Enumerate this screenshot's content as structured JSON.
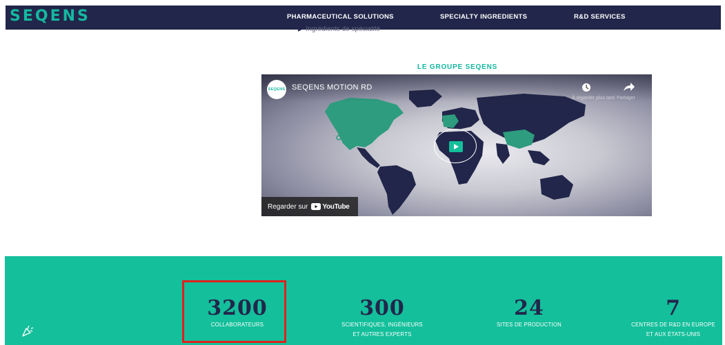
{
  "header": {
    "logo": "SEQENS",
    "nav": [
      "PHARMACEUTICAL SOLUTIONS",
      "SPECIALTY INGREDIENTS",
      "R&D SERVICES"
    ]
  },
  "cutoff_text": "Ingrédients de spécialité",
  "section_title": "LE GROUPE SEQENS",
  "video": {
    "channel_avatar_text": "SEQENS",
    "title": "SEQENS MOTION RD",
    "clock_label": "À regarder plus tard",
    "share_label": "Partager",
    "watch_on_label": "Regarder sur",
    "youtube_label": "YouTube"
  },
  "stats": [
    {
      "number": "3200",
      "label_line1": "COLLABORATEURS",
      "label_line2": ""
    },
    {
      "number": "300",
      "label_line1": "SCIENTIFIQUES, INGÉNIEURS",
      "label_line2": "ET AUTRES EXPERTS"
    },
    {
      "number": "24",
      "label_line1": "SITES DE PRODUCTION",
      "label_line2": ""
    },
    {
      "number": "7",
      "label_line1": "CENTRES DE R&D EN EUROPE",
      "label_line2": "ET AUX ÉTATS-UNIS"
    }
  ],
  "colors": {
    "navy": "#22264a",
    "teal": "#14bf9b",
    "highlight": "#e0201e"
  },
  "icons": [
    "clock-icon",
    "share-icon",
    "play-icon",
    "youtube-icon",
    "confetti-icon",
    "location-pin-icon"
  ]
}
